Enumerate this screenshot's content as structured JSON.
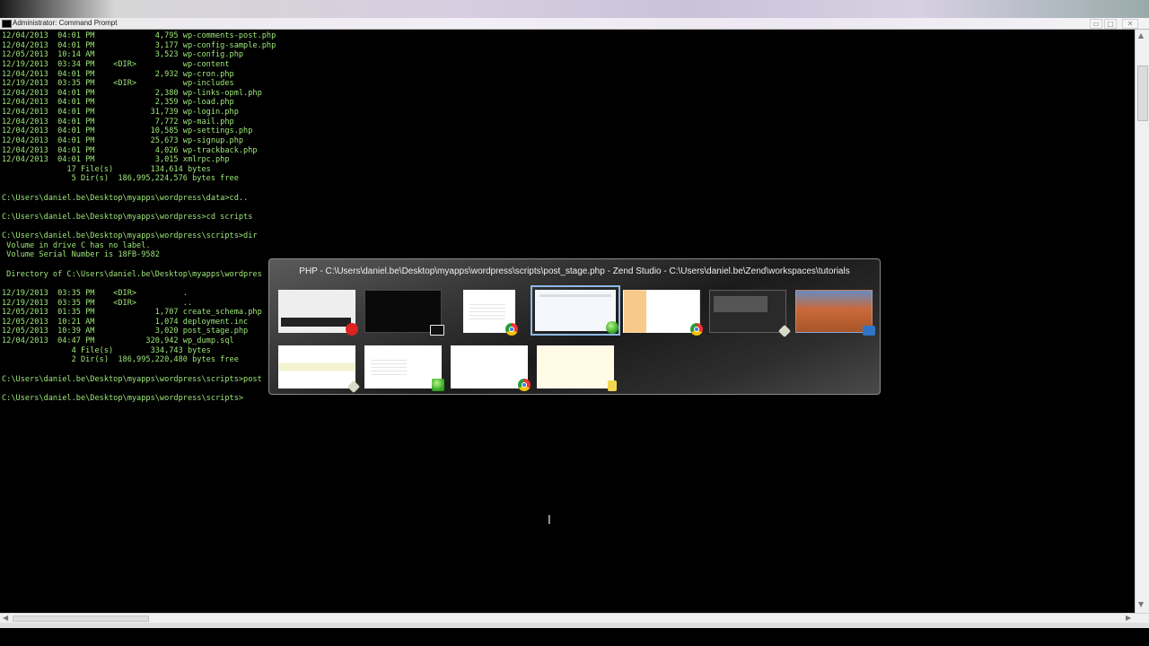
{
  "window": {
    "title": "Administrator: Command Prompt",
    "buttons": {
      "minimize": "▭",
      "maximize": "□",
      "close": "✕"
    }
  },
  "console": {
    "lines": [
      "12/04/2013  04:01 PM             4,795 wp-comments-post.php",
      "12/04/2013  04:01 PM             3,177 wp-config-sample.php",
      "12/05/2013  10:14 AM             3,523 wp-config.php",
      "12/19/2013  03:34 PM    <DIR>          wp-content",
      "12/04/2013  04:01 PM             2,932 wp-cron.php",
      "12/19/2013  03:35 PM    <DIR>          wp-includes",
      "12/04/2013  04:01 PM             2,380 wp-links-opml.php",
      "12/04/2013  04:01 PM             2,359 wp-load.php",
      "12/04/2013  04:01 PM            31,739 wp-login.php",
      "12/04/2013  04:01 PM             7,772 wp-mail.php",
      "12/04/2013  04:01 PM            10,585 wp-settings.php",
      "12/04/2013  04:01 PM            25,673 wp-signup.php",
      "12/04/2013  04:01 PM             4,026 wp-trackback.php",
      "12/04/2013  04:01 PM             3,015 xmlrpc.php",
      "              17 File(s)        134,614 bytes",
      "               5 Dir(s)  186,995,224,576 bytes free",
      "",
      "C:\\Users\\daniel.be\\Desktop\\myapps\\wordpress\\data>cd..",
      "",
      "C:\\Users\\daniel.be\\Desktop\\myapps\\wordpress>cd scripts",
      "",
      "C:\\Users\\daniel.be\\Desktop\\myapps\\wordpress\\scripts>dir",
      " Volume in drive C has no label.",
      " Volume Serial Number is 18FB-9582",
      "",
      " Directory of C:\\Users\\daniel.be\\Desktop\\myapps\\wordpres",
      "",
      "12/19/2013  03:35 PM    <DIR>          .",
      "12/19/2013  03:35 PM    <DIR>          ..",
      "12/05/2013  01:35 PM             1,707 create_schema.php",
      "12/05/2013  10:21 AM             1,074 deployment.inc",
      "12/05/2013  10:39 AM             3,020 post_stage.php",
      "12/04/2013  04:47 PM           320,942 wp_dump.sql",
      "               4 File(s)        334,743 bytes",
      "               2 Dir(s)  186,995,220,480 bytes free",
      "",
      "C:\\Users\\daniel.be\\Desktop\\myapps\\wordpress\\scripts>post",
      "",
      "C:\\Users\\daniel.be\\Desktop\\myapps\\wordpress\\scripts>"
    ]
  },
  "switcher": {
    "caption": "PHP - C:\\Users\\daniel.be\\Desktop\\myapps\\wordpress\\scripts\\post_stage.php - Zend Studio - C:\\Users\\daniel.be\\Zend\\workspaces\\tutorials",
    "windows": [
      {
        "name": "window-thumb-media-player",
        "badge": "red-badge",
        "icon": "media-player-icon"
      },
      {
        "name": "window-thumb-command-prompt",
        "badge": "cmd-badge",
        "icon": "command-prompt-icon"
      },
      {
        "name": "window-thumb-chrome-1",
        "badge": "chrome-badge",
        "icon": "chrome-icon"
      },
      {
        "name": "window-thumb-zend-studio",
        "badge": "green-badge",
        "icon": "zend-studio-icon"
      },
      {
        "name": "window-thumb-chrome-2",
        "badge": "chrome-badge",
        "icon": "chrome-icon"
      },
      {
        "name": "window-thumb-recorder",
        "badge": "grey-badge",
        "icon": "recorder-icon"
      },
      {
        "name": "window-thumb-desktop",
        "badge": "blue-badge",
        "icon": "desktop-icon"
      },
      {
        "name": "window-thumb-notepad",
        "badge": "grey-badge",
        "icon": "notepad-icon"
      },
      {
        "name": "window-thumb-document",
        "badge": "green-badge",
        "icon": "document-icon"
      },
      {
        "name": "window-thumb-chrome-3",
        "badge": "chrome-badge",
        "icon": "chrome-icon"
      },
      {
        "name": "window-thumb-folder",
        "badge": "yellow-badge",
        "icon": "folder-icon"
      }
    ]
  },
  "cursor": {
    "glyph": "I"
  }
}
